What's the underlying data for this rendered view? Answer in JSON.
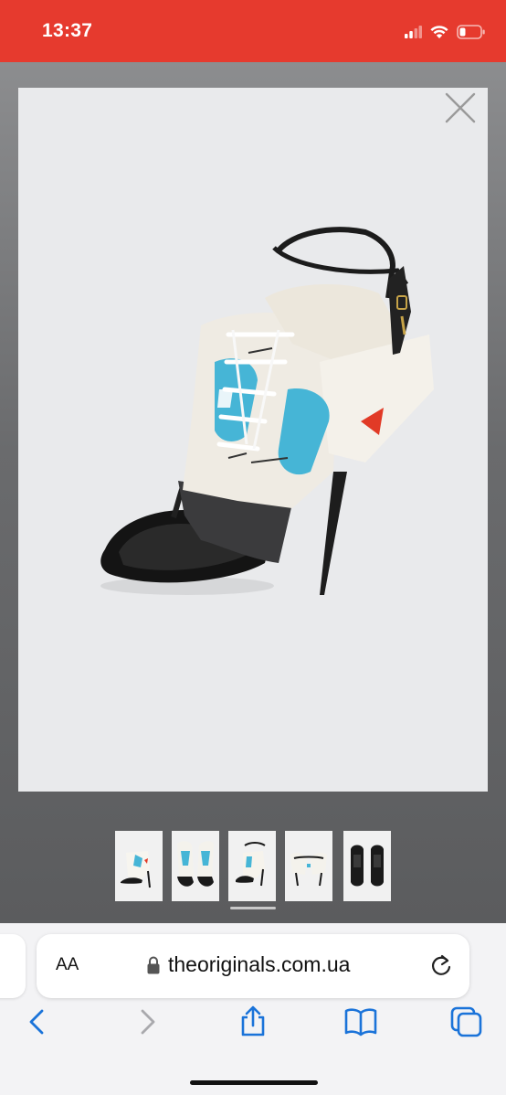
{
  "status_bar": {
    "time": "13:37",
    "background_color": "#e63a2e",
    "icons": [
      "cellular-signal-icon",
      "wifi-icon",
      "battery-icon"
    ]
  },
  "gallery": {
    "main_image_alt": "White and blue sneaker-style heeled thong sandal with black ankle strap",
    "close_icon": "close-icon",
    "thumbnails": [
      {
        "name": "thumbnail-1",
        "selected": false
      },
      {
        "name": "thumbnail-2",
        "selected": false
      },
      {
        "name": "thumbnail-3",
        "selected": true
      },
      {
        "name": "thumbnail-4",
        "selected": false
      },
      {
        "name": "thumbnail-5",
        "selected": false
      }
    ]
  },
  "browser": {
    "text_size_label": "AA",
    "url": "theoriginals.com.ua",
    "toolbar_icons": [
      "back-icon",
      "forward-icon",
      "share-icon",
      "bookmarks-icon",
      "tabs-icon"
    ],
    "accent_color": "#1a73d9"
  }
}
